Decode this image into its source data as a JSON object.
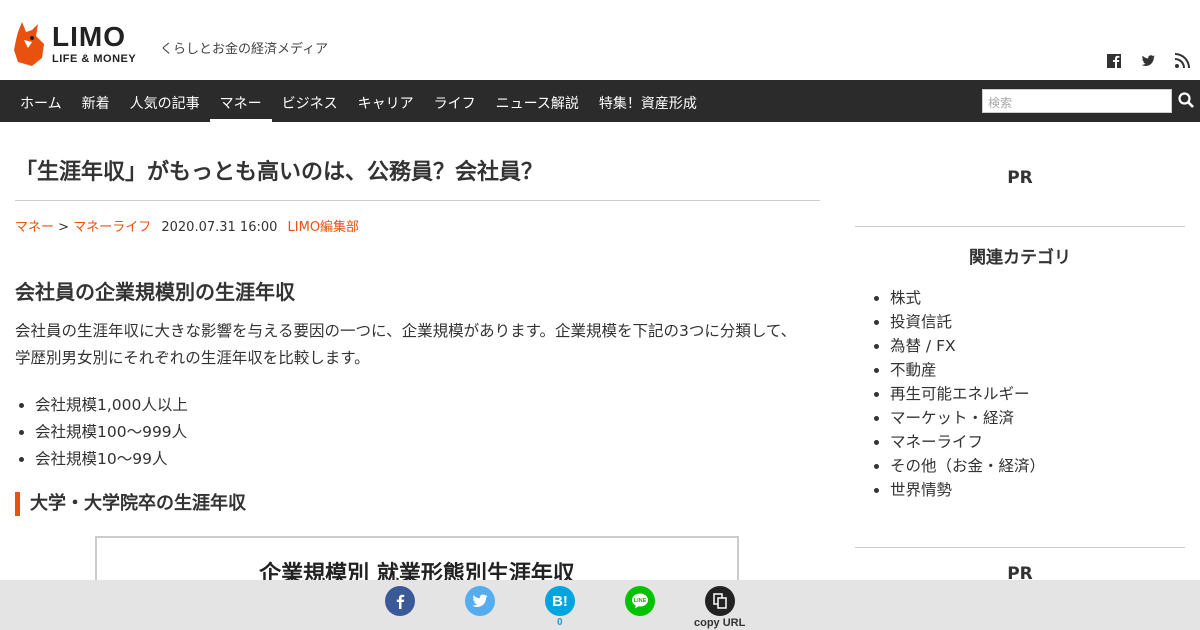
{
  "header": {
    "logo_name": "LIMO",
    "logo_sub": "LIFE & MONEY",
    "tagline": "くらしとお金の経済メディア",
    "social_icons": [
      "facebook-icon",
      "twitter-icon",
      "rss-icon"
    ]
  },
  "nav": {
    "items": [
      "ホーム",
      "新着",
      "人気の記事",
      "マネー",
      "ビジネス",
      "キャリア",
      "ライフ",
      "ニュース解説",
      "特集！資産形成"
    ],
    "active": "マネー",
    "search_placeholder": "検索"
  },
  "article": {
    "title": "「生涯年収」がもっとも高いのは、公務員？会社員？",
    "breadcrumb": [
      "マネー",
      "マネーライフ"
    ],
    "breadcrumb_sep": ">",
    "date": "2020.07.31 16:00",
    "author": "LIMO編集部",
    "h2": "会社員の企業規模別の生涯年収",
    "paragraph": "会社員の生涯年収に大きな影響を与える要因の一つに、企業規模があります。企業規模を下記の3つに分類して、学歴別男女別にそれぞれの生涯年収を比較します。",
    "bullets": [
      "会社規模1,000人以上",
      "会社規模100～999人",
      "会社規模10～99人"
    ],
    "h3": "大学・大学院卒の生涯年収",
    "figure_title": "企業規模別 就業形態別生涯年収"
  },
  "sidebar": {
    "pr_top": "PR",
    "heading": "関連カテゴリ",
    "categories": [
      "株式",
      "投資信託",
      "為替 / FX",
      "不動産",
      "再生可能エネルギー",
      "マーケット・経済",
      "マネーライフ",
      "その他（お金・経済）",
      "世界情勢"
    ],
    "pr_bottom": "PR"
  },
  "share": {
    "hatena_label": "B!",
    "hatena_count": "0",
    "copy_label": "copy URL",
    "colors": {
      "facebook": "#3b5998",
      "twitter": "#55acee",
      "hatena": "#00a4de",
      "line": "#00c300",
      "copy": "#222222"
    }
  },
  "colors": {
    "accent": "#e8520e",
    "nav_bg": "#2b2b2b"
  }
}
